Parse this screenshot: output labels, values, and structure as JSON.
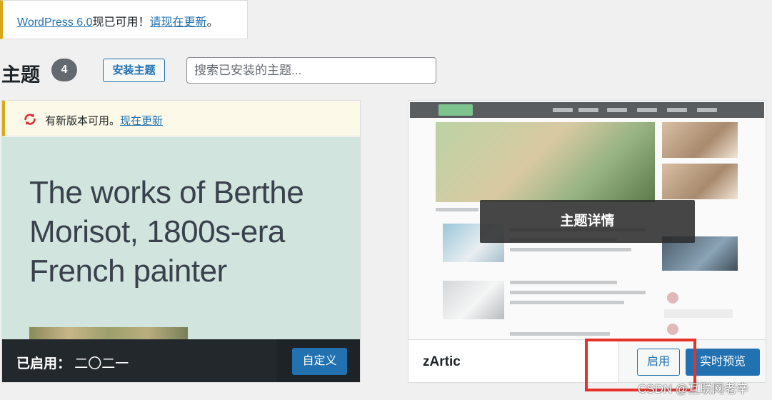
{
  "notice": {
    "link_version": "WordPress 6.0",
    "middle_text": "现已可用！",
    "link_update": "请现在更新",
    "end_text": "。"
  },
  "header": {
    "title": "主题",
    "count": "4",
    "install_label": "安装主题",
    "search_placeholder": "搜索已安装的主题..."
  },
  "themes": [
    {
      "update_text": "有新版本可用。",
      "update_link": "现在更新",
      "screenshot_headline": "The works of Berthe Morisot, 1800s-era French painter",
      "active_prefix": "已启用：",
      "name": "二〇二一",
      "customize_label": "自定义"
    },
    {
      "details_label": "主题详情",
      "name": "zArtic",
      "activate_label": "启用",
      "preview_label": "实时预览"
    }
  ],
  "watermark": "CSDN @互联网老辛",
  "colors": {
    "accent": "#2271b1",
    "notice_border": "#dba617",
    "annotation_red": "#e8302b"
  }
}
